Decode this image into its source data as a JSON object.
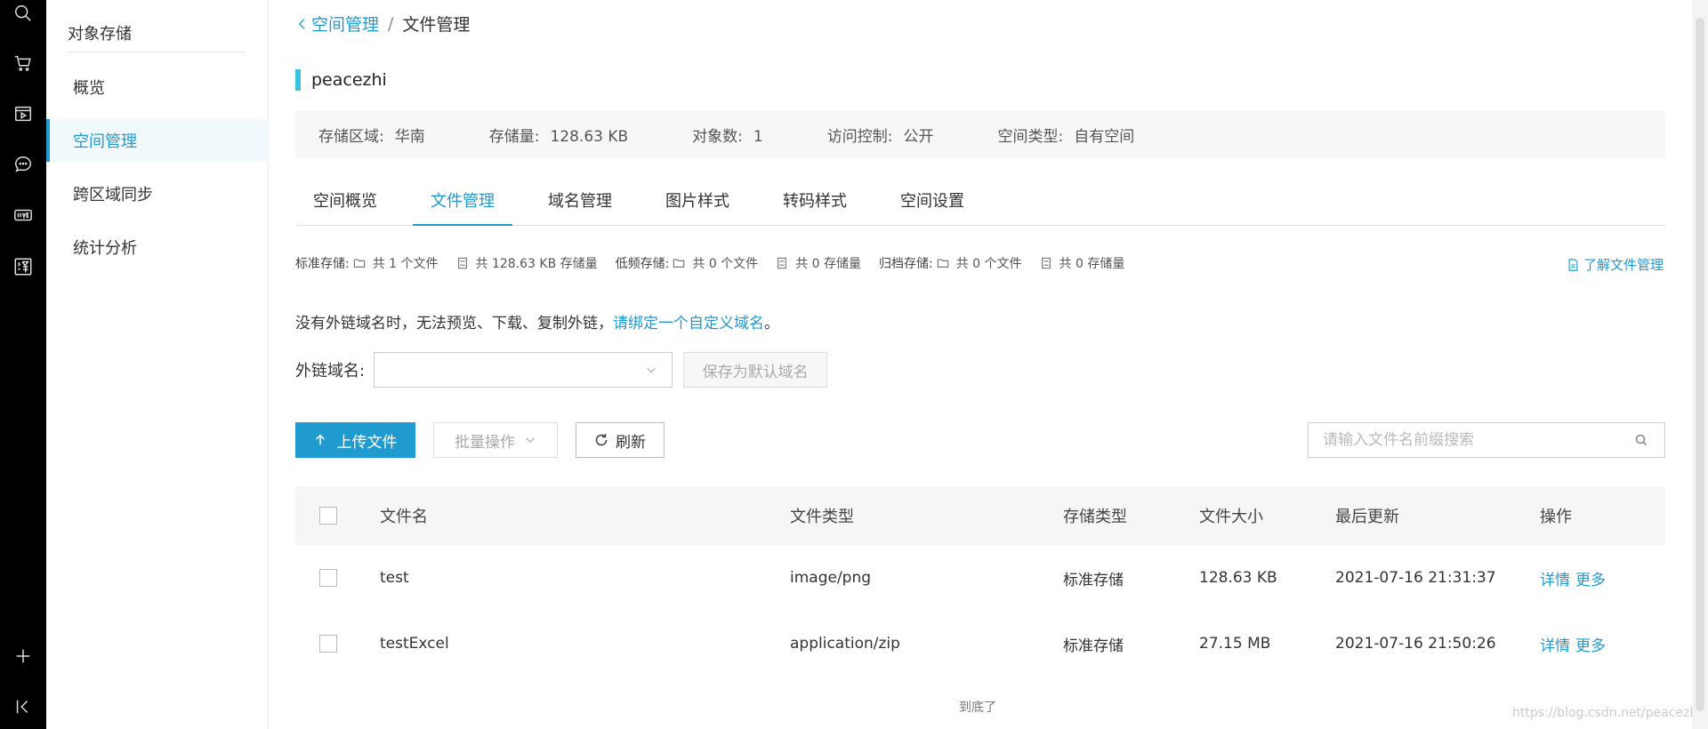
{
  "rail": {
    "icons": [
      "search-icon",
      "cart-icon",
      "media-icon",
      "chat-icon",
      "live-icon",
      "translate-icon",
      "plus-icon",
      "collapse-icon"
    ]
  },
  "sidebar": {
    "title": "对象存储",
    "items": [
      {
        "label": "概览",
        "active": false
      },
      {
        "label": "空间管理",
        "active": true
      },
      {
        "label": "跨区域同步",
        "active": false
      },
      {
        "label": "统计分析",
        "active": false
      }
    ]
  },
  "breadcrumb": {
    "parent": "空间管理",
    "separator": "/",
    "current": "文件管理"
  },
  "bucket": {
    "name": "peacezhi"
  },
  "info": {
    "region_label": "存储区域:",
    "region_value": "华南",
    "size_label": "存储量:",
    "size_value": "128.63 KB",
    "objects_label": "对象数:",
    "objects_value": "1",
    "access_label": "访问控制:",
    "access_value": "公开",
    "type_label": "空间类型:",
    "type_value": "自有空间"
  },
  "tabs": [
    {
      "label": "空间概览",
      "active": false
    },
    {
      "label": "文件管理",
      "active": true
    },
    {
      "label": "域名管理",
      "active": false
    },
    {
      "label": "图片样式",
      "active": false
    },
    {
      "label": "转码样式",
      "active": false
    },
    {
      "label": "空间设置",
      "active": false
    }
  ],
  "stats": {
    "standard_label": "标准存储:",
    "standard_files": "共 1 个文件",
    "standard_size": "共 128.63 KB 存储量",
    "low_label": "低频存储:",
    "low_files": "共 0 个文件",
    "low_size": "共 0 存储量",
    "archive_label": "归档存储:",
    "archive_files": "共 0 个文件",
    "archive_size": "共 0 存储量",
    "learn_link": "了解文件管理"
  },
  "notice": {
    "text": "没有外链域名时，无法预览、下载、复制外链，",
    "link": "请绑定一个自定义域名",
    "suffix": "。"
  },
  "domain": {
    "label": "外链域名:",
    "value": "",
    "save_button": "保存为默认域名"
  },
  "toolbar": {
    "upload": "上传文件",
    "batch": "批量操作",
    "refresh": "刷新",
    "search_placeholder": "请输入文件名前缀搜索"
  },
  "table": {
    "headers": {
      "name": "文件名",
      "type": "文件类型",
      "storage": "存储类型",
      "size": "文件大小",
      "updated": "最后更新",
      "actions": "操作"
    },
    "rows": [
      {
        "name": "test",
        "type": "image/png",
        "storage": "标准存储",
        "size": "128.63 KB",
        "updated": "2021-07-16 21:31:37",
        "detail": "详情",
        "more": "更多"
      },
      {
        "name": "testExcel",
        "type": "application/zip",
        "storage": "标准存储",
        "size": "27.15 MB",
        "updated": "2021-07-16 21:50:26",
        "detail": "详情",
        "more": "更多"
      }
    ]
  },
  "footer": {
    "end_text": "到底了",
    "watermark": "https://blog.csdn.net/peacezhi"
  },
  "colors": {
    "accent": "#1f9bd0",
    "bucket_bar": "#3ac3e0",
    "rail": "#000000"
  }
}
